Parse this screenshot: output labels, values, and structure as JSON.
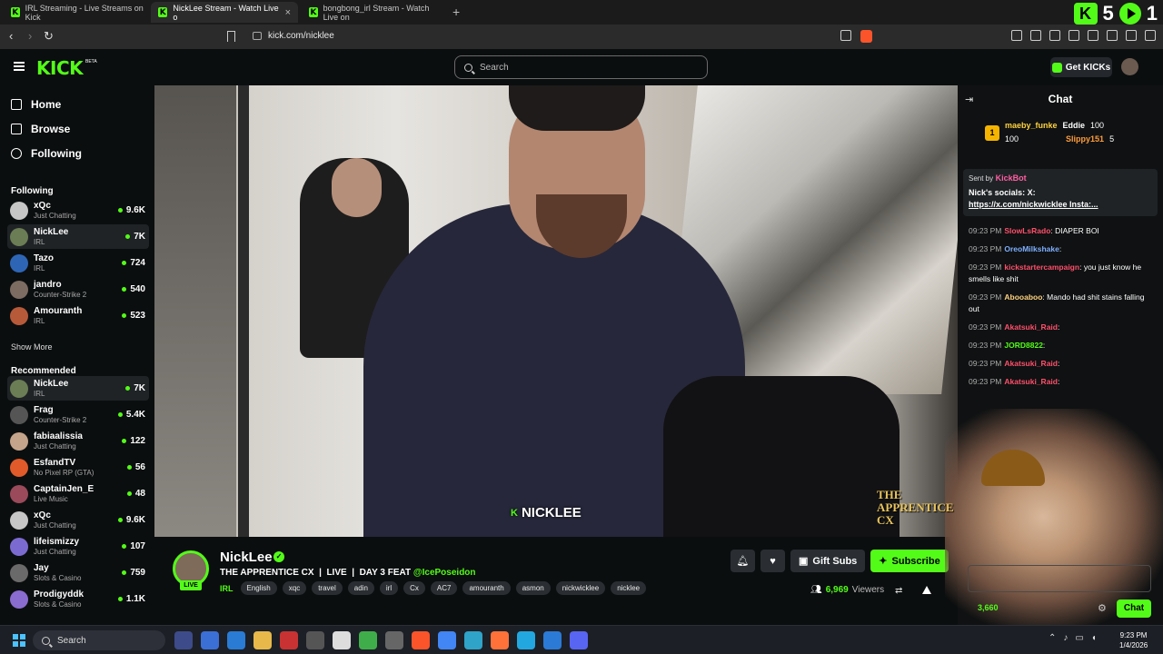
{
  "browser": {
    "tabs": [
      {
        "label": "IRL Streaming - Live Streams on Kick",
        "active": false
      },
      {
        "label": "NickLee Stream - Watch Live o",
        "active": true
      },
      {
        "label": "bongbong_irl Stream - Watch Live on",
        "active": false
      }
    ],
    "new_tab": "+",
    "url": "kick.com/nicklee",
    "extension_badges": {
      "kick_count": "5",
      "other_count": "1"
    }
  },
  "header": {
    "logo": "KICK",
    "logo_badge": "BETA",
    "search_placeholder": "Search",
    "get_kicks_label": "Get KICKs"
  },
  "sidebar": {
    "nav": [
      {
        "label": "Home",
        "icon": "home-icon"
      },
      {
        "label": "Browse",
        "icon": "browse-icon"
      },
      {
        "label": "Following",
        "icon": "heart-icon"
      }
    ],
    "following_title": "Following",
    "following": [
      {
        "name": "xQc",
        "category": "Just Chatting",
        "viewers": "9.6K",
        "color": "#c6c6c6"
      },
      {
        "name": "NickLee",
        "category": "IRL",
        "viewers": "7K",
        "color": "#6b7d54"
      },
      {
        "name": "Tazo",
        "category": "IRL",
        "viewers": "724",
        "color": "#2e66b5"
      },
      {
        "name": "jandro",
        "category": "Counter-Strike 2",
        "viewers": "540",
        "color": "#7d6c62"
      },
      {
        "name": "Amouranth",
        "category": "IRL",
        "viewers": "523",
        "color": "#b75a3a"
      }
    ],
    "show_more": "Show More",
    "recommended_title": "Recommended",
    "recommended": [
      {
        "name": "NickLee",
        "category": "IRL",
        "viewers": "7K",
        "color": "#6b7d54"
      },
      {
        "name": "Frag",
        "category": "Counter-Strike 2",
        "viewers": "5.4K",
        "color": "#555555"
      },
      {
        "name": "fabiaalissia",
        "category": "Just Chatting",
        "viewers": "122",
        "color": "#c4a48a"
      },
      {
        "name": "EsfandTV",
        "category": "No Pixel RP (GTA)",
        "viewers": "56",
        "color": "#e05a2a"
      },
      {
        "name": "CaptainJen_E",
        "category": "Live Music",
        "viewers": "48",
        "color": "#9a4a5a"
      },
      {
        "name": "xQc",
        "category": "Just Chatting",
        "viewers": "9.6K",
        "color": "#c6c6c6"
      },
      {
        "name": "lifeismizzy",
        "category": "Just Chatting",
        "viewers": "107",
        "color": "#7b6bd0"
      },
      {
        "name": "Jay",
        "category": "Slots & Casino",
        "viewers": "759",
        "color": "#6a6a6a"
      },
      {
        "name": "Prodigyddk",
        "category": "Slots & Casino",
        "viewers": "1.1K",
        "color": "#8a6bd0"
      }
    ]
  },
  "video": {
    "watermark": "NICKLEE",
    "overlay_text": "THE APPRENTICE CX"
  },
  "stream": {
    "name": "NickLee",
    "live_badge": "LIVE",
    "title_prefix": "THE APPRENTICE CX  |  LIVE  |  DAY 3 FEAT ",
    "title_mention": "@IcePoseidon",
    "category": "IRL",
    "tags": [
      "English",
      "xqc",
      "travel",
      "adin",
      "irl",
      "Cx",
      "AC7",
      "amouranth",
      "asmon",
      "nickwicklee",
      "nicklee"
    ],
    "gift_subs_label": "Gift Subs",
    "subscribe_label": "Subscribe",
    "viewers": "6,969",
    "viewers_label": "Viewers"
  },
  "chat": {
    "title": "Chat",
    "gifters": [
      {
        "rank": "1",
        "name": "maeby_funke",
        "count": "100"
      },
      {
        "name": "Eddie",
        "count": "100"
      },
      {
        "name": "Slippy151",
        "count": "5"
      }
    ],
    "pinned": {
      "sent_by": "Sent by",
      "bot": "KickBot",
      "message_line1": "Nick's socials: X:",
      "message_line2": "https://x.com/nickwicklee Insta:..."
    },
    "messages": [
      {
        "time": "09:23 PM",
        "user": "SlowLsRado",
        "color": "#ff4f6b",
        "text": "DIAPER BOI"
      },
      {
        "time": "09:23 PM",
        "user": "OreoMilkshake",
        "color": "#7fb0ff",
        "text": ""
      },
      {
        "time": "09:23 PM",
        "user": "kickstartercampaign",
        "color": "#ff4f6b",
        "text": "you just know he smells like shit"
      },
      {
        "time": "09:23 PM",
        "user": "Abooaboo",
        "color": "#ffd27f",
        "text": "Mando had shit stains falling out"
      },
      {
        "time": "09:23 PM",
        "user": "Akatsuki_Raid",
        "color": "#ff4f6b",
        "text": ""
      },
      {
        "time": "09:23 PM",
        "user": "JORD8822",
        "color": "#53fc18",
        "text": ""
      },
      {
        "time": "09:23 PM",
        "user": "Akatsuki_Raid",
        "color": "#ff4f6b",
        "text": ""
      },
      {
        "time": "09:23 PM",
        "user": "Akatsuki_Raid",
        "color": "#ff4f6b",
        "text": ""
      }
    ],
    "viewer_count": "3,660",
    "send_label": "Chat"
  },
  "taskbar": {
    "search_placeholder": "Search",
    "time": "9:23 PM",
    "date": "1/4/2026"
  }
}
